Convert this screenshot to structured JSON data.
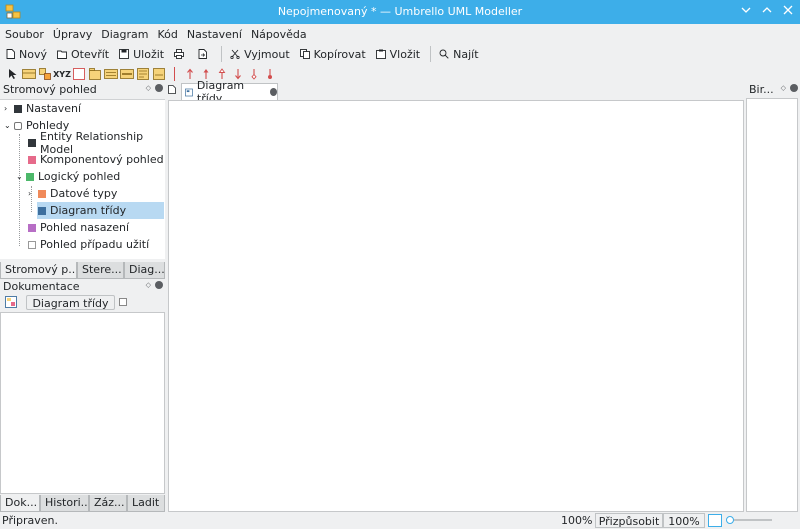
{
  "window": {
    "title": "Nepojmenovaný * — Umbrello UML Modeller",
    "minimize_icon": "chevron-down-icon",
    "maximize_icon": "chevron-up-icon",
    "close_icon": "close-icon"
  },
  "menu": [
    "Soubor",
    "Úpravy",
    "Diagram",
    "Kód",
    "Nastavení",
    "Nápověda"
  ],
  "toolbar": {
    "new": "Nový",
    "open": "Otevřít",
    "save": "Uložit",
    "cut": "Vyjmout",
    "copy": "Kopírovat",
    "paste": "Vložit",
    "find": "Najít"
  },
  "diagram_toolbar": {
    "xyz_label": "XYZ"
  },
  "tree_panel": {
    "title": "Stromový pohled",
    "items": [
      {
        "label": "Nastavení"
      },
      {
        "label": "Pohledy"
      },
      {
        "label": "Entity Relationship Model"
      },
      {
        "label": "Komponentový pohled"
      },
      {
        "label": "Logický pohled"
      },
      {
        "label": "Datové typy"
      },
      {
        "label": "Diagram třídy"
      },
      {
        "label": "Pohled nasazení"
      },
      {
        "label": "Pohled případu užití"
      }
    ],
    "tabs": [
      "Stromový p...",
      "Stere...",
      "Diag..."
    ]
  },
  "doc_panel": {
    "title": "Dokumentace",
    "diagram_button": "Diagram třídy",
    "tabs": [
      "Dok...",
      "Histori...",
      "Záz...",
      "Ladit"
    ]
  },
  "editor": {
    "tab_label": "Diagram třídy"
  },
  "right_panel": {
    "title": "Bir..."
  },
  "status": {
    "text": "Připraven.",
    "zoom": "100%",
    "fit_button": "Přizpůsobit",
    "zoom_button": "100%"
  },
  "colors": {
    "titlebar": "#3daee9",
    "selection": "#b8d9f2",
    "arrow_red": "#d24d4d"
  }
}
